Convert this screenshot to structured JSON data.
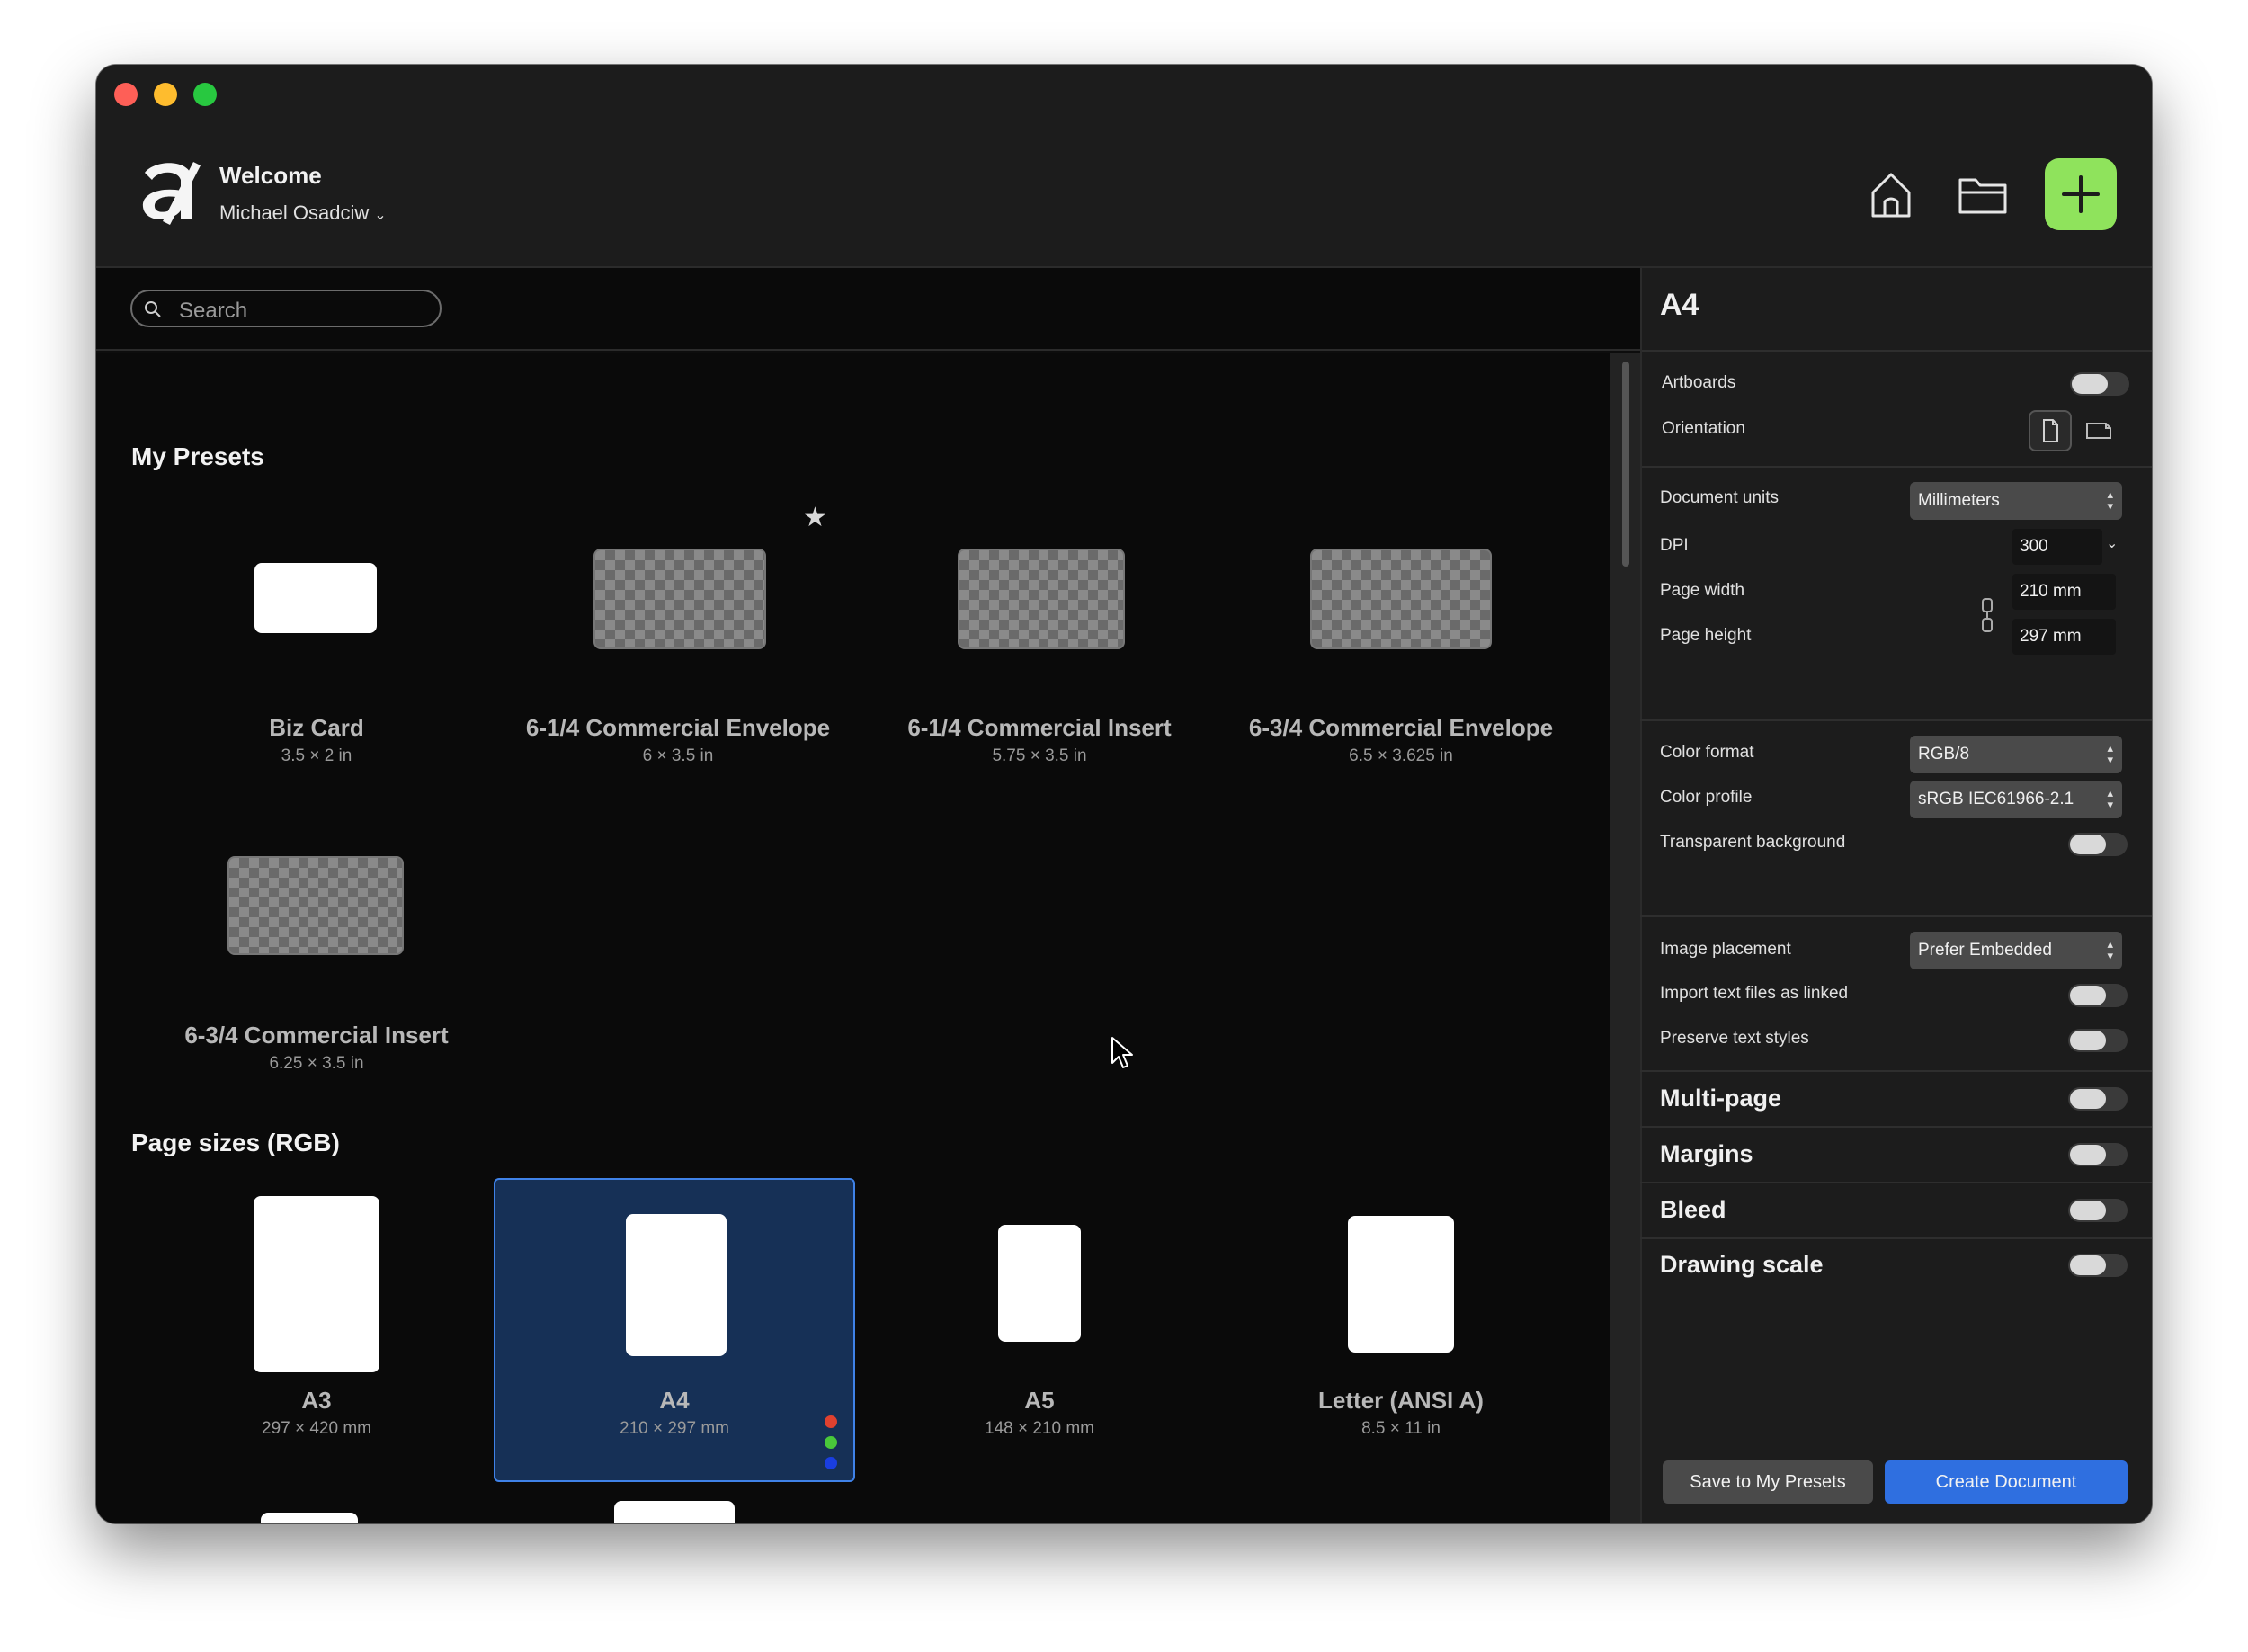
{
  "window": {
    "controls": [
      "close",
      "minimize",
      "zoom"
    ]
  },
  "header": {
    "welcome": "Welcome",
    "user": "Michael Osadciw",
    "icons": {
      "logo": "affinity-logo",
      "home": "home-icon",
      "folder": "folder-icon",
      "new": "plus-icon"
    }
  },
  "search": {
    "placeholder": "Search"
  },
  "sections": {
    "my_presets": "My Presets",
    "page_sizes": "Page sizes (RGB)"
  },
  "my_presets": [
    {
      "name": "Biz Card",
      "size": "3.5 × 2 in"
    },
    {
      "name": "6-1/4 Commercial Envelope",
      "size": "6 × 3.5 in",
      "starred": true
    },
    {
      "name": "6-1/4 Commercial Insert",
      "size": "5.75 × 3.5 in"
    },
    {
      "name": "6-3/4 Commercial Envelope",
      "size": "6.5 × 3.625 in"
    },
    {
      "name": "6-3/4 Commercial Insert",
      "size": "6.25 × 3.5 in"
    }
  ],
  "page_sizes": [
    {
      "name": "A3",
      "size": "297 × 420 mm"
    },
    {
      "name": "A4",
      "size": "210 × 297 mm",
      "selected": true
    },
    {
      "name": "A5",
      "size": "148 × 210 mm"
    },
    {
      "name": "Letter (ANSI A)",
      "size": "8.5 × 11 in"
    }
  ],
  "rgb_dots": [
    "#e0412f",
    "#49c83a",
    "#1a3ee0"
  ],
  "panel": {
    "title": "A4",
    "artboards": {
      "label": "Artboards",
      "on": false
    },
    "orientation": {
      "label": "Orientation",
      "selected": "portrait"
    },
    "document_units": {
      "label": "Document units",
      "value": "Millimeters"
    },
    "dpi": {
      "label": "DPI",
      "value": "300"
    },
    "page_width": {
      "label": "Page width",
      "value": "210 mm"
    },
    "page_height": {
      "label": "Page height",
      "value": "297 mm"
    },
    "color_format": {
      "label": "Color format",
      "value": "RGB/8"
    },
    "color_profile": {
      "label": "Color profile",
      "value": "sRGB IEC61966-2.1"
    },
    "transparent_background": {
      "label": "Transparent background",
      "on": false
    },
    "image_placement": {
      "label": "Image placement",
      "value": "Prefer Embedded"
    },
    "import_text_linked": {
      "label": "Import text files as linked",
      "on": false
    },
    "preserve_text_styles": {
      "label": "Preserve text styles",
      "on": false
    },
    "multi_page": {
      "label": "Multi-page",
      "on": false
    },
    "margins": {
      "label": "Margins",
      "on": false
    },
    "bleed": {
      "label": "Bleed",
      "on": false
    },
    "drawing_scale": {
      "label": "Drawing scale",
      "on": false
    },
    "save_button": "Save to My Presets",
    "create_button": "Create Document"
  },
  "colors": {
    "accent": "#2f6fe0",
    "new_button": "#8fe35c",
    "selection": "#163056"
  }
}
